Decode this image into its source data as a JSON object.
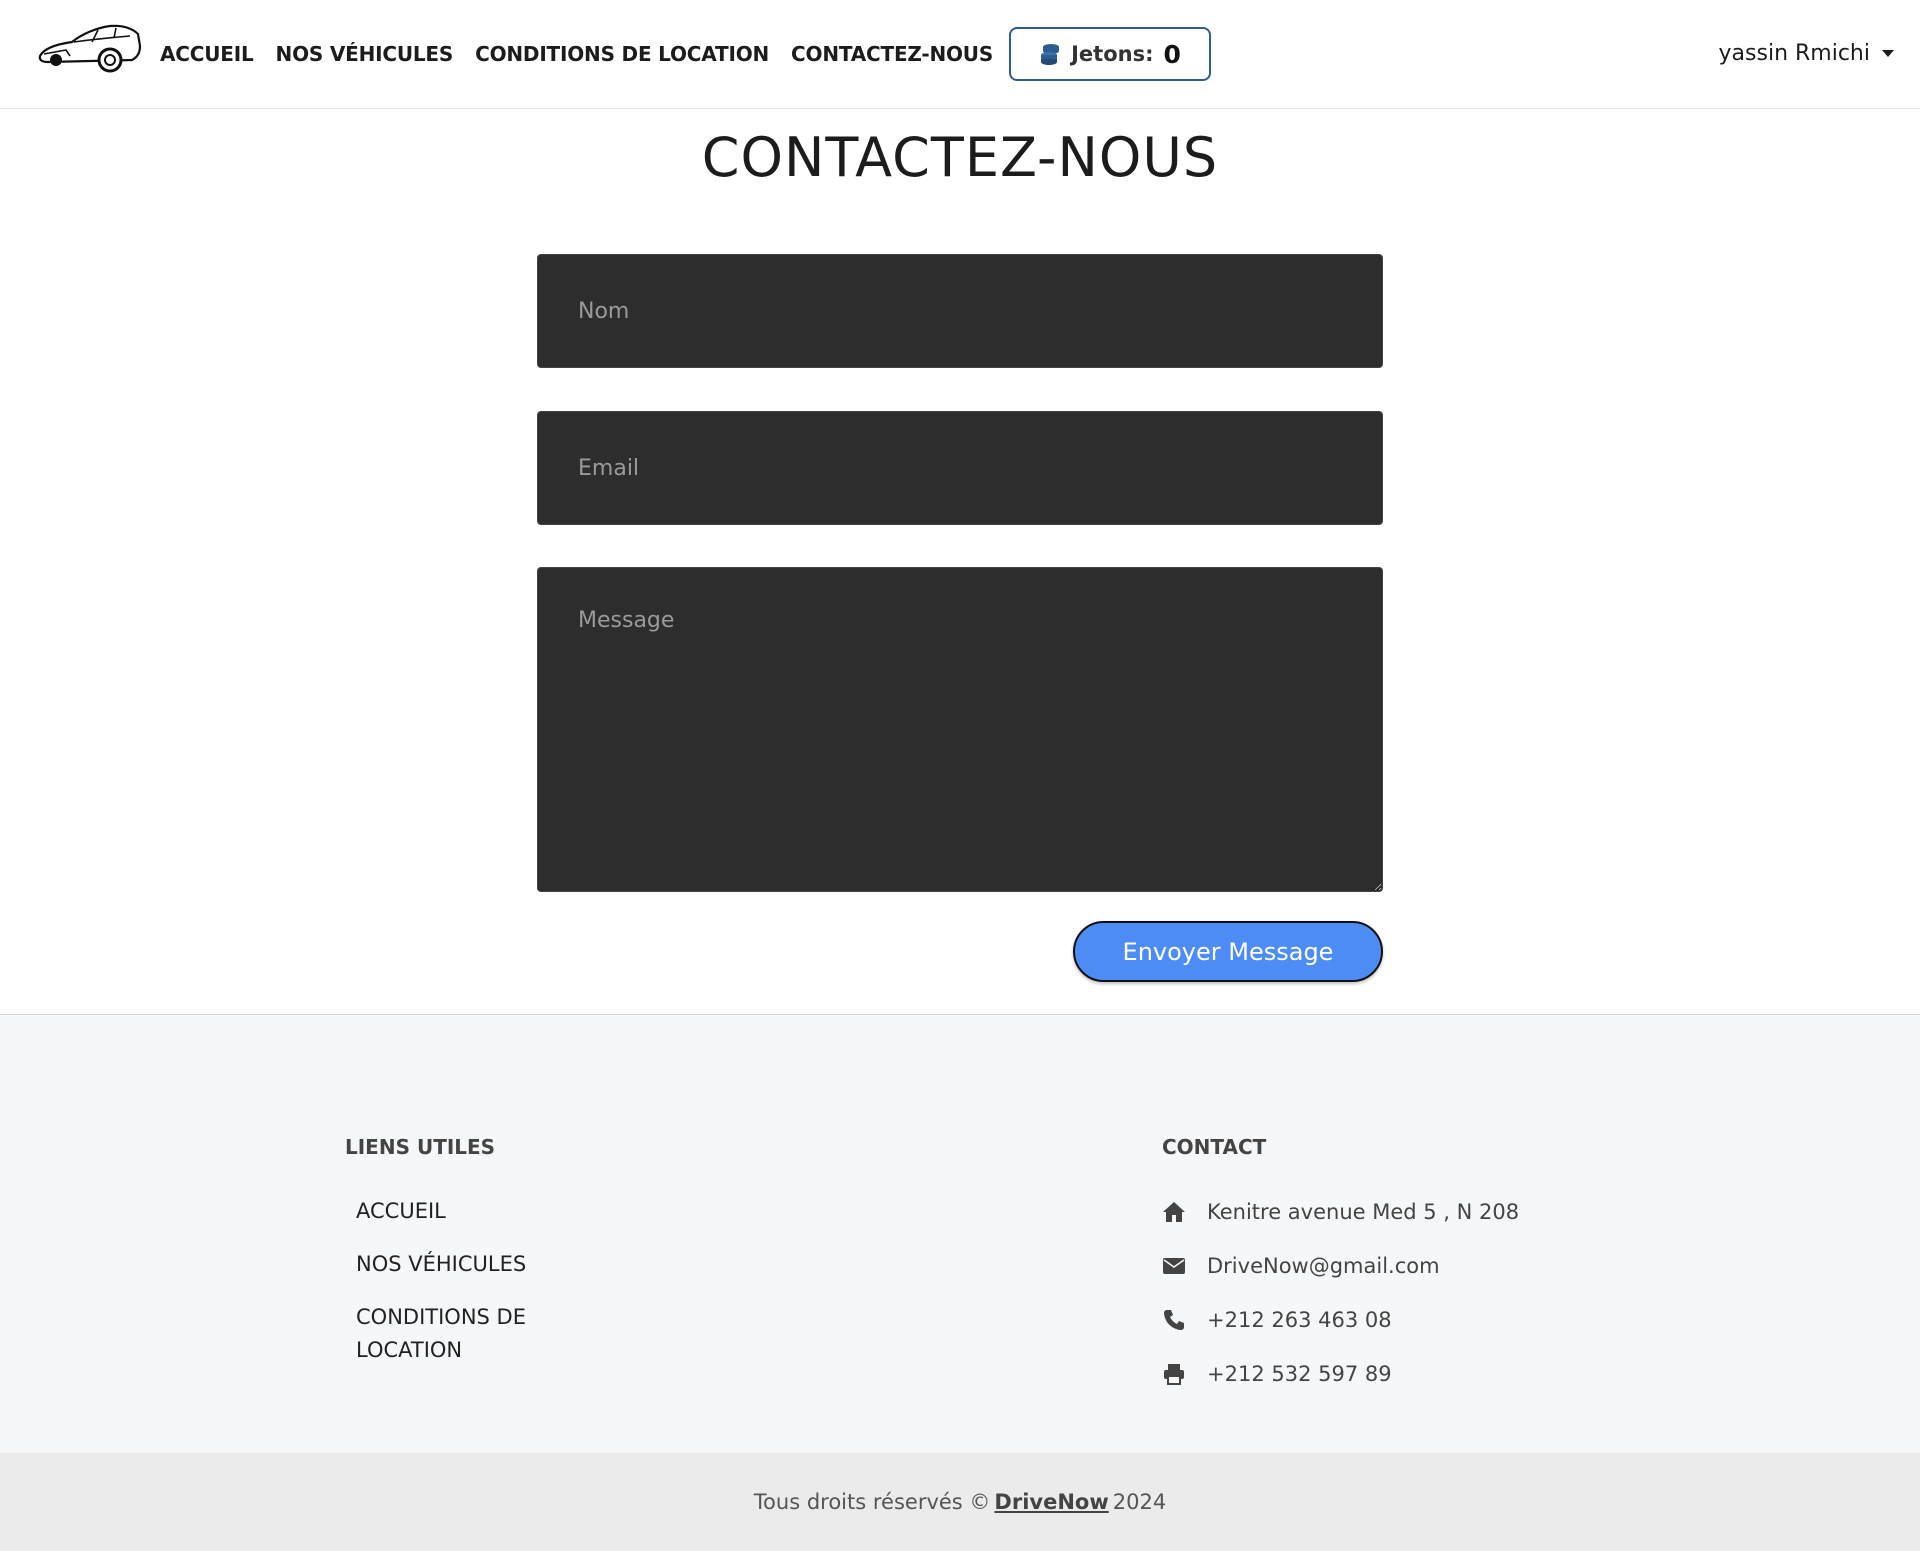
{
  "nav": {
    "links": [
      "ACCUEIL",
      "NOS VÉHICULES",
      "CONDITIONS DE LOCATION",
      "CONTACTEZ-NOUS"
    ],
    "jetons_label": "Jetons:",
    "jetons_value": "0",
    "user_name": "yassin Rmichi"
  },
  "main": {
    "title": "CONTACTEZ-NOUS",
    "name_placeholder": "Nom",
    "email_placeholder": "Email",
    "message_placeholder": "Message",
    "send_label": "Envoyer Message"
  },
  "footer": {
    "links_heading": "LIENS UTILES",
    "links": [
      "ACCUEIL",
      "NOS VÉHICULES",
      "CONDITIONS DE LOCATION"
    ],
    "contact_heading": "CONTACT",
    "contact": [
      {
        "icon": "home-icon",
        "text": "Kenitre avenue Med 5 , N 208"
      },
      {
        "icon": "envelope-icon",
        "text": "DriveNow@gmail.com"
      },
      {
        "icon": "phone-icon",
        "text": "+212 263 463 08"
      },
      {
        "icon": "printer-icon",
        "text": "+212 532 597 89"
      }
    ],
    "copyright_prefix": "Tous droits réservés ©",
    "brand": "DriveNow",
    "year": "2024"
  },
  "colors": {
    "primary_button": "#4d8bf5",
    "field_background": "#2d2d2d",
    "jetons_border": "#2d5d8f",
    "footer_background": "#f5f7f9",
    "copyright_background": "#ebebeb"
  }
}
